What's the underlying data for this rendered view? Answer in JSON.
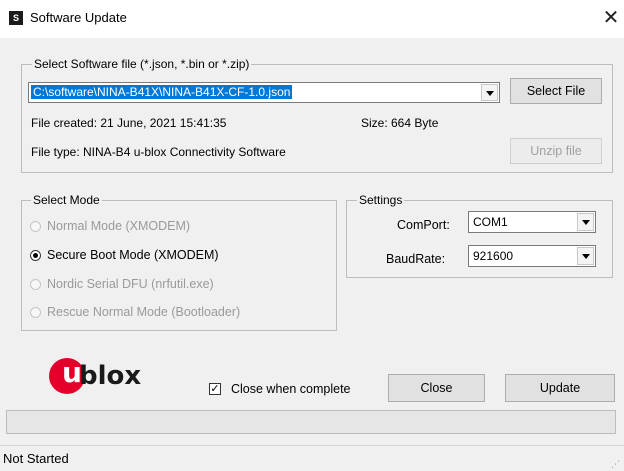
{
  "window": {
    "title": "Software Update",
    "app_icon": "S",
    "close_glyph": "✕"
  },
  "file_group": {
    "label": "Select Software file (*.json, *.bin or *.zip)",
    "path_value": "C:\\software\\NINA-B41X\\NINA-B41X-CF-1.0.json",
    "select_button": "Select File",
    "file_created": "File created: 21 June, 2021 15:41:35",
    "size": "Size: 664 Byte",
    "file_type": "File type: NINA-B4 u-blox Connectivity Software",
    "unzip_button": "Unzip file"
  },
  "mode_group": {
    "label": "Select Mode",
    "options": [
      {
        "label": "Normal Mode (XMODEM)",
        "selected": false,
        "enabled": false
      },
      {
        "label": "Secure Boot Mode (XMODEM)",
        "selected": true,
        "enabled": true
      },
      {
        "label": "Nordic Serial DFU (nrfutil.exe)",
        "selected": false,
        "enabled": false
      },
      {
        "label": "Rescue Normal Mode (Bootloader)",
        "selected": false,
        "enabled": false
      }
    ]
  },
  "settings_group": {
    "label": "Settings",
    "comport_label": "ComPort:",
    "comport_value": "COM1",
    "baudrate_label": "BaudRate:",
    "baudrate_value": "921600"
  },
  "footer": {
    "logo_text": "blox",
    "logo_letter": "u",
    "close_when_complete_label": "Close when complete",
    "close_when_complete_checked": true,
    "check_glyph": "✓",
    "close_button": "Close",
    "update_button": "Update",
    "progress_fraction": 0
  },
  "status": {
    "text": "Not Started"
  },
  "colors": {
    "selection": "#0078d7",
    "logo_red": "#e4002b",
    "logo_dark": "#1a1a1a"
  }
}
